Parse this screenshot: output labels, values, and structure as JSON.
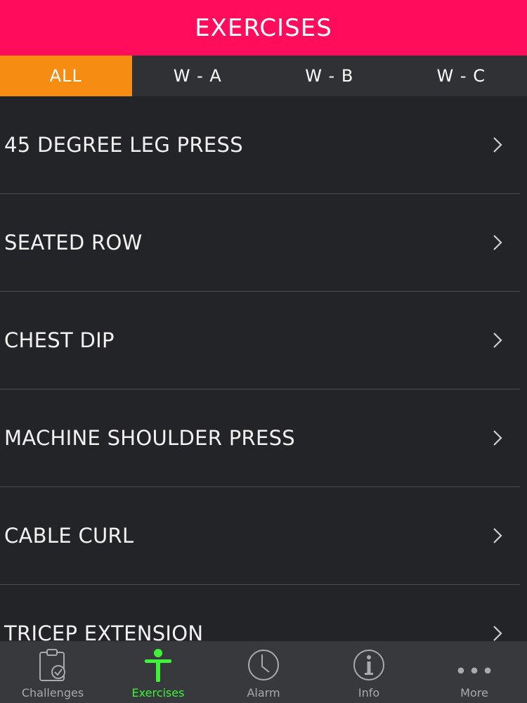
{
  "header": {
    "title": "EXERCISES"
  },
  "segments": [
    {
      "label": "ALL",
      "active": true
    },
    {
      "label": "W - A",
      "active": false
    },
    {
      "label": "W - B",
      "active": false
    },
    {
      "label": "W - C",
      "active": false
    }
  ],
  "exercises": [
    {
      "name": "45 DEGREE LEG PRESS"
    },
    {
      "name": "SEATED ROW"
    },
    {
      "name": "CHEST DIP"
    },
    {
      "name": "MACHINE SHOULDER PRESS"
    },
    {
      "name": "CABLE CURL"
    },
    {
      "name": "TRICEP EXTENSION"
    }
  ],
  "tabbar": {
    "items": [
      {
        "label": "Challenges",
        "icon": "clipboard-check-icon",
        "active": false
      },
      {
        "label": "Exercises",
        "icon": "person-icon",
        "active": true
      },
      {
        "label": "Alarm",
        "icon": "clock-icon",
        "active": false
      },
      {
        "label": "Info",
        "icon": "info-icon",
        "active": false
      },
      {
        "label": "More",
        "icon": "more-dots-icon",
        "active": false
      }
    ]
  },
  "colors": {
    "header_bg": "#ff0c5c",
    "active_segment": "#f78c12",
    "active_tab": "#3ef33a",
    "background": "#232427"
  }
}
